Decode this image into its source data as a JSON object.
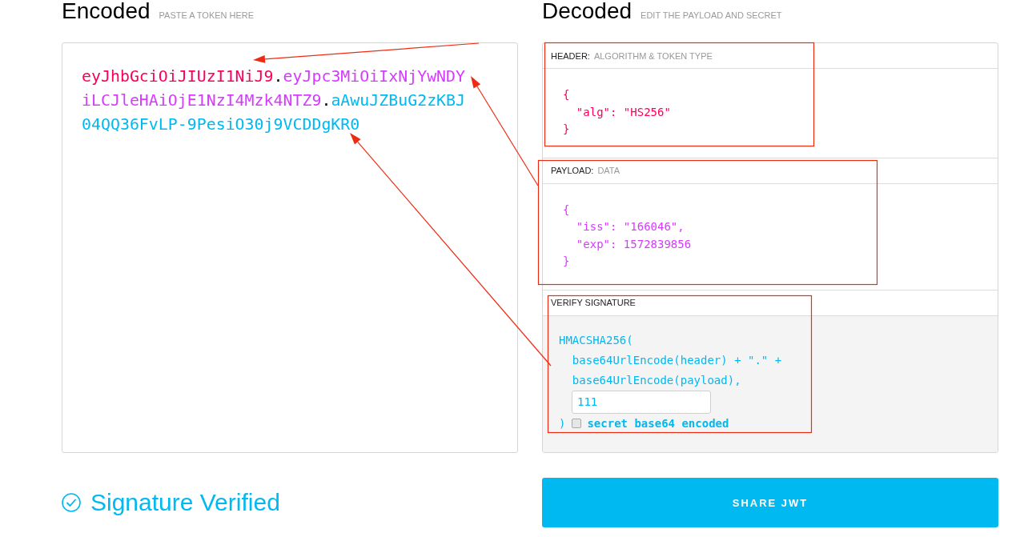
{
  "encoded": {
    "title": "Encoded",
    "hint": "PASTE A TOKEN HERE",
    "token_parts": [
      {
        "kind": "header",
        "text": "eyJhbGciOiJIUzI1NiJ9"
      },
      {
        "kind": "dot",
        "text": "."
      },
      {
        "kind": "payload",
        "text": "eyJpc3MiOiIxNjYwNDYiLCJleHAiOjE1NzI4Mzk4NTZ9"
      },
      {
        "kind": "dot",
        "text": "."
      },
      {
        "kind": "signature",
        "text": "aAwuJZBuG2zKBJ04QQ36FvLP-9PesiO30j9VCDDgKR0"
      }
    ]
  },
  "decoded": {
    "title": "Decoded",
    "hint": "EDIT THE PAYLOAD AND SECRET",
    "sections": [
      {
        "kind": "header",
        "label": "HEADER:",
        "hint": "ALGORITHM & TOKEN TYPE",
        "lines": [
          "{",
          "  \"alg\": \"HS256\"",
          "}"
        ]
      },
      {
        "kind": "payload",
        "label": "PAYLOAD:",
        "hint": "DATA",
        "lines": [
          "{",
          "  \"iss\": \"166046\",",
          "  \"exp\": 1572839856",
          "}"
        ]
      }
    ],
    "verify_signature": {
      "label": "VERIFY SIGNATURE",
      "lines": [
        "HMACSHA256(",
        "  base64UrlEncode(header) + \".\" +",
        "  base64UrlEncode(payload),"
      ],
      "secret": {
        "value": "111"
      },
      "closing": ")",
      "base64_checkbox": {
        "label": "secret base64 encoded",
        "checked": false
      }
    }
  },
  "status": {
    "text": "Signature Verified"
  },
  "share_button": {
    "label": "SHARE JWT"
  }
}
